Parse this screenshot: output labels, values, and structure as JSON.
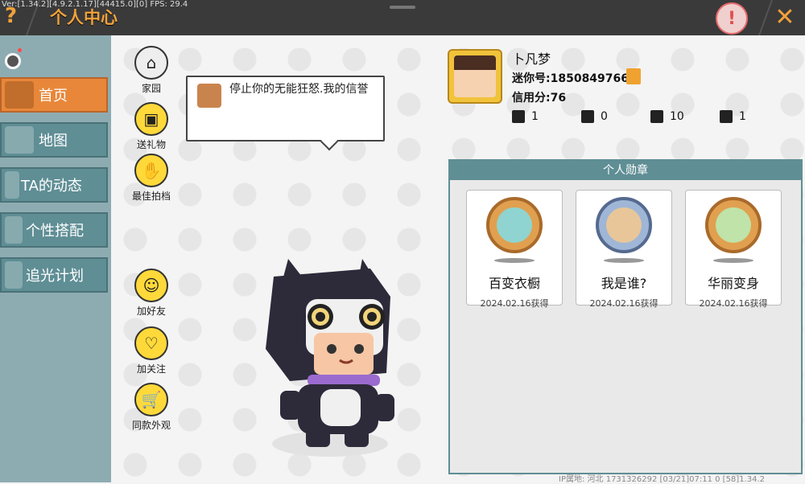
{
  "debug": "Ver:[1.34.2][4.9.2.1.17][44415.0][0] FPS: 29.4",
  "header": {
    "title": "个人中心",
    "help_glyph": "?",
    "close_glyph": "✕",
    "warn_glyph": "!"
  },
  "sidebar": {
    "items": [
      {
        "label": "首页",
        "active": true
      },
      {
        "label": "地图"
      },
      {
        "label": "TA的动态"
      },
      {
        "label": "个性搭配"
      },
      {
        "label": "追光计划"
      }
    ]
  },
  "actions_top": [
    {
      "label": "家园",
      "icon": "home-icon"
    },
    {
      "label": "送礼物",
      "icon": "gift-icon"
    },
    {
      "label": "最佳拍档",
      "icon": "handshake-icon"
    }
  ],
  "actions_bottom": [
    {
      "label": "加好友",
      "icon": "add-friend-icon"
    },
    {
      "label": "加关注",
      "icon": "heart-icon"
    },
    {
      "label": "同款外观",
      "icon": "cart-icon"
    }
  ],
  "bubble": {
    "text": "停止你的无能狂怒.我的信誉"
  },
  "profile": {
    "name": "卜凡梦",
    "id": "迷你号:1850849766",
    "credit": "信用分:76",
    "stats": [
      "1",
      "0",
      "10",
      "1"
    ]
  },
  "medals": {
    "title": "个人勋章",
    "items": [
      {
        "name": "百变衣橱",
        "date": "2024.02.16获得"
      },
      {
        "name": "我是谁?",
        "date": "2024.02.16获得"
      },
      {
        "name": "华丽变身",
        "date": "2024.02.16获得"
      }
    ]
  },
  "footer": "IP属地: 河北    1731326292    [03/21]07:11 0    [58]1.34.2",
  "colors": {
    "accent": "#f2a13a",
    "nav": "#5f8e95",
    "nav_active": "#e8873a"
  }
}
